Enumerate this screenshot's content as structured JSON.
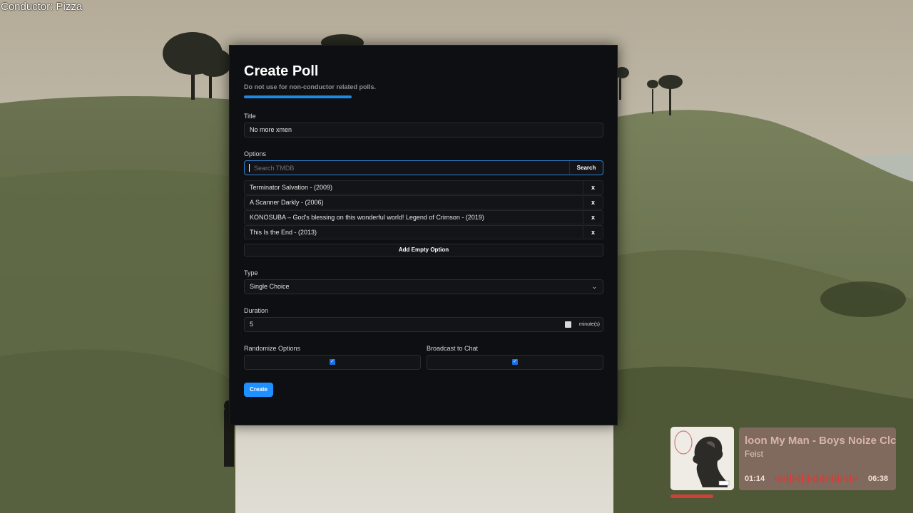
{
  "overlay": {
    "label": "Conductor: Pizza"
  },
  "modal": {
    "title": "Create Poll",
    "subtitle": "Do not use for non-conductor related polls.",
    "accent_color": "#1e88e5"
  },
  "form": {
    "title_label": "Title",
    "title_value": "No more xmen",
    "options_label": "Options",
    "search_placeholder": "Search TMDB",
    "search_button": "Search",
    "options": [
      {
        "label": "Terminator Salvation - (2009)",
        "remove": "x"
      },
      {
        "label": "A Scanner Darkly - (2006)",
        "remove": "x"
      },
      {
        "label": "KONOSUBA – God's blessing on this wonderful world! Legend of Crimson - (2019)",
        "remove": "x"
      },
      {
        "label": "This Is the End - (2013)",
        "remove": "x"
      }
    ],
    "add_empty_option": "Add Empty Option",
    "type_label": "Type",
    "type_value": "Single Choice",
    "duration_label": "Duration",
    "duration_value": "5",
    "duration_unit": "minute(s)",
    "randomize_label": "Randomize Options",
    "randomize_checked": true,
    "broadcast_label": "Broadcast to Chat",
    "broadcast_checked": true,
    "create_button": "Create",
    "create_color": "#1e90ff"
  },
  "now_playing": {
    "title": "loon My Man - Boys Noize Clc",
    "artist": "Feist",
    "elapsed": "01:14",
    "total": "06:38",
    "progress_fraction": 0.19,
    "accent_color": "#d0403a",
    "album_art_icon": "silhouette-portrait-icon"
  }
}
